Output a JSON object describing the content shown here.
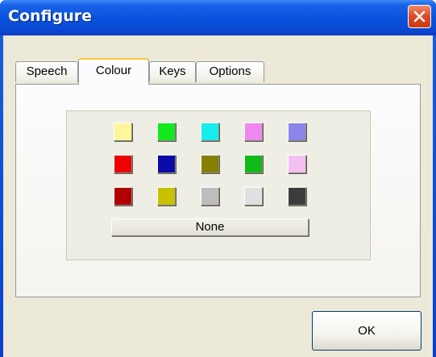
{
  "window": {
    "title": "Configure"
  },
  "tabs": [
    {
      "label": "Speech",
      "active": false
    },
    {
      "label": "Colour",
      "active": true
    },
    {
      "label": "Keys",
      "active": false
    },
    {
      "label": "Options",
      "active": false
    }
  ],
  "colour_grid": {
    "rows": [
      [
        "#fff59a",
        "#12e81e",
        "#16ecec",
        "#ee88ee",
        "#8a86ec"
      ],
      [
        "#ee0000",
        "#0a0aa8",
        "#858000",
        "#10ba18",
        "#f4c0f4"
      ],
      [
        "#b00000",
        "#c8c000",
        "#bdbdbd",
        "#e0e0e0",
        "#3c3c3c"
      ]
    ],
    "none_label": "None"
  },
  "buttons": {
    "ok_label": "OK"
  },
  "icons": {
    "close": "close-icon"
  }
}
